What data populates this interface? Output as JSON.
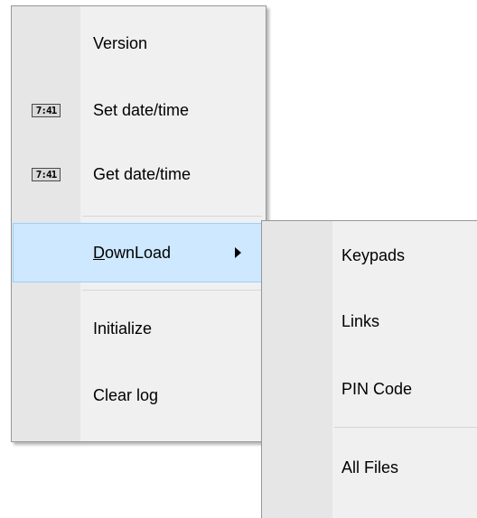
{
  "main_menu": {
    "items": [
      {
        "label": "Version",
        "icon": null
      },
      {
        "label": "Set date/time",
        "icon": "clock-icon",
        "icon_text": "7:41"
      },
      {
        "label": "Get date/time",
        "icon": "clock-icon",
        "icon_text": "7:41"
      },
      {
        "label_mnemonic": "D",
        "label_rest": "ownLoad",
        "has_submenu": true,
        "highlighted": true
      },
      {
        "label": "Initialize"
      },
      {
        "label": "Clear log"
      }
    ]
  },
  "download_submenu": {
    "items": [
      {
        "label": "Keypads"
      },
      {
        "label": "Links"
      },
      {
        "label": "PIN Code"
      },
      {
        "label": "All Files"
      }
    ]
  },
  "colors": {
    "menu_bg": "#f0f0f0",
    "gutter_bg": "#e6e6e6",
    "highlight_bg": "#cde8ff",
    "highlight_border": "#99d1ff"
  }
}
